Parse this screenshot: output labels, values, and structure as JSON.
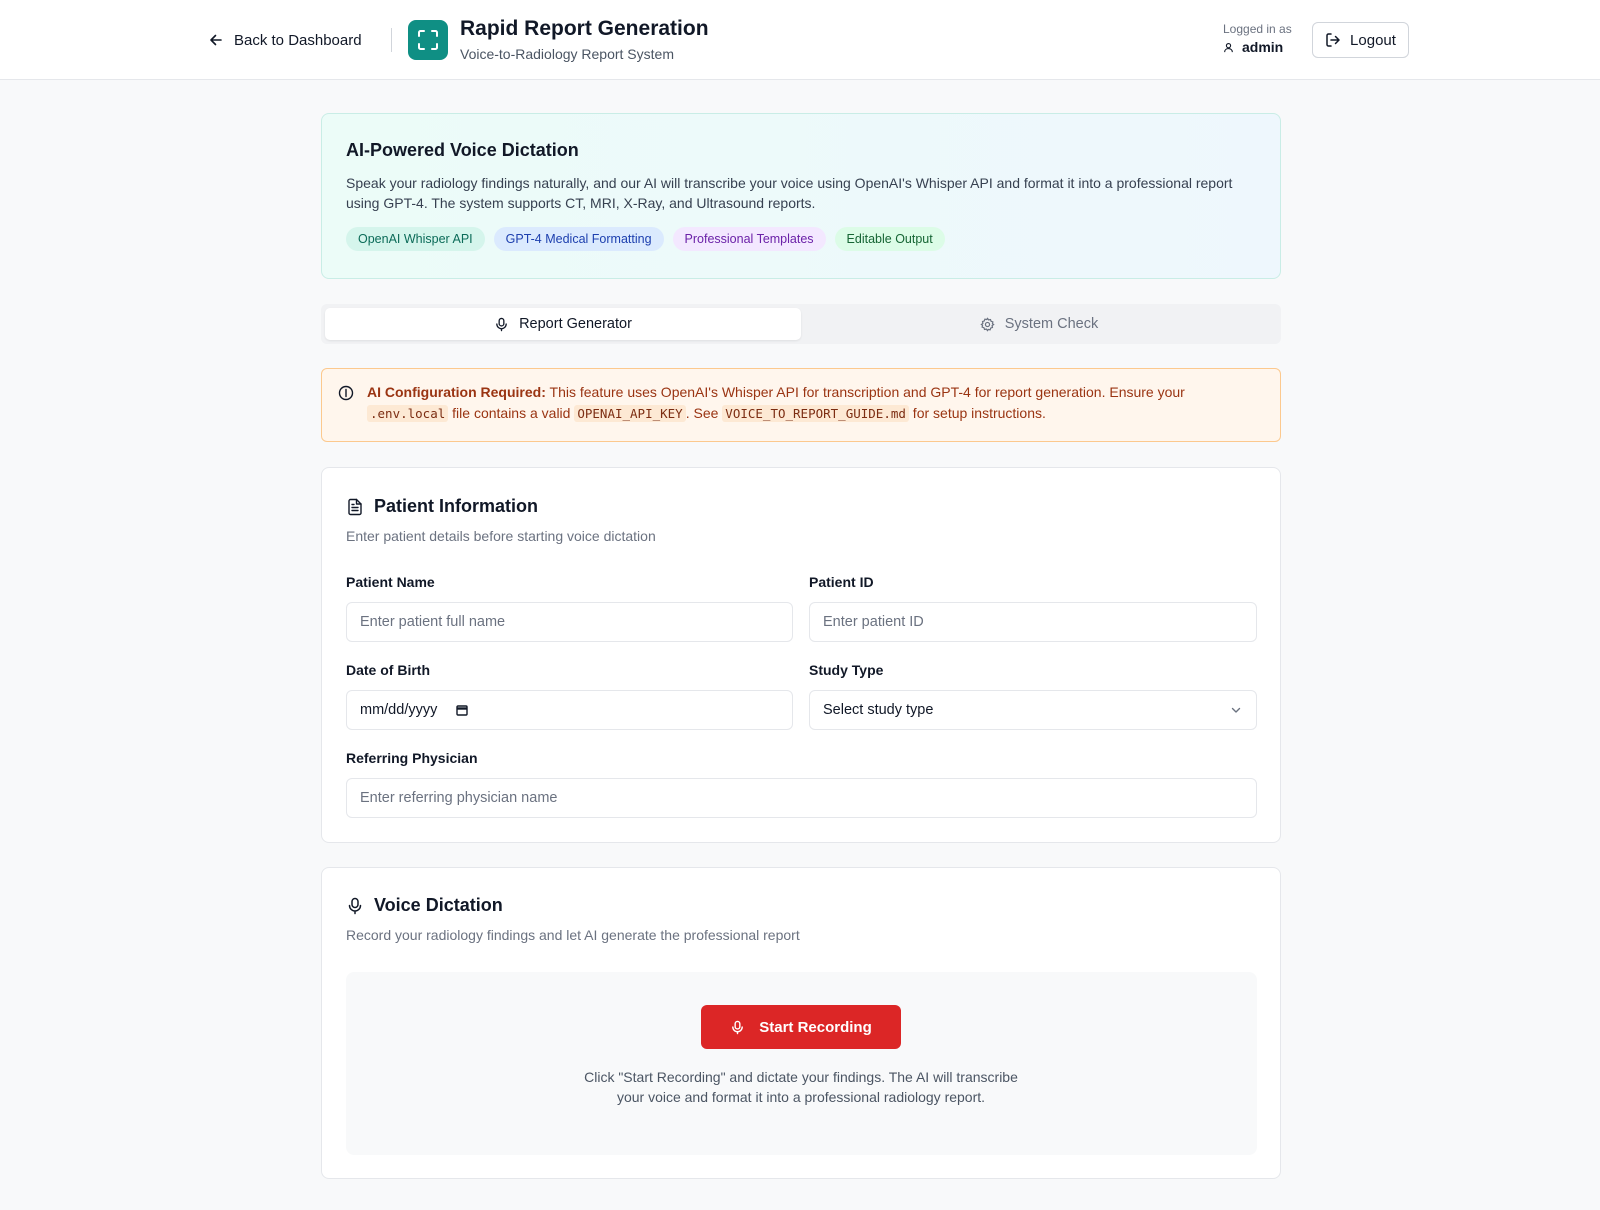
{
  "header": {
    "back_label": "Back to Dashboard",
    "title": "Rapid Report Generation",
    "subtitle": "Voice-to-Radiology Report System",
    "logged_in_label": "Logged in as",
    "username": "admin",
    "logout_label": "Logout",
    "brand_color": "#0f8f84"
  },
  "intro": {
    "title": "AI-Powered Voice Dictation",
    "description": "Speak your radiology findings naturally, and our AI will transcribe your voice using OpenAI's Whisper API and format it into a professional report using GPT-4. The system supports CT, MRI, X-Ray, and Ultrasound reports.",
    "badges": [
      {
        "label": "OpenAI Whisper API",
        "bg": "#d5f5ec",
        "fg": "#0b6b58"
      },
      {
        "label": "GPT-4 Medical Formatting",
        "bg": "#dbeafe",
        "fg": "#1e40af"
      },
      {
        "label": "Professional Templates",
        "bg": "#f3e8ff",
        "fg": "#6b21a8"
      },
      {
        "label": "Editable Output",
        "bg": "#dcfce7",
        "fg": "#166534"
      }
    ]
  },
  "tabs": [
    {
      "label": "Report Generator",
      "icon": "mic-icon",
      "active": true
    },
    {
      "label": "System Check",
      "icon": "gear-icon",
      "active": false
    }
  ],
  "alert": {
    "title": "AI Configuration Required:",
    "text_1": " This feature uses OpenAI's Whisper API for transcription and GPT-4 for report generation. Ensure your ",
    "code_1": ".env.local",
    "text_2": " file contains a valid ",
    "code_2": "OPENAI_API_KEY",
    "text_3": ". See ",
    "code_3": "VOICE_TO_REPORT_GUIDE.md",
    "text_4": " for setup instructions."
  },
  "patient": {
    "title": "Patient Information",
    "description": "Enter patient details before starting voice dictation",
    "name_label": "Patient Name",
    "name_placeholder": "Enter patient full name",
    "id_label": "Patient ID",
    "id_placeholder": "Enter patient ID",
    "dob_label": "Date of Birth",
    "dob_value": "mm/dd/yyyy",
    "study_label": "Study Type",
    "study_value": "Select study type",
    "physician_label": "Referring Physician",
    "physician_placeholder": "Enter referring physician name"
  },
  "dictation": {
    "title": "Voice Dictation",
    "description": "Record your radiology findings and let AI generate the professional report",
    "record_label": "Start Recording",
    "help_text": "Click \"Start Recording\" and dictate your findings. The AI will transcribe your voice and format it into a professional radiology report.",
    "record_color": "#dc2626"
  }
}
